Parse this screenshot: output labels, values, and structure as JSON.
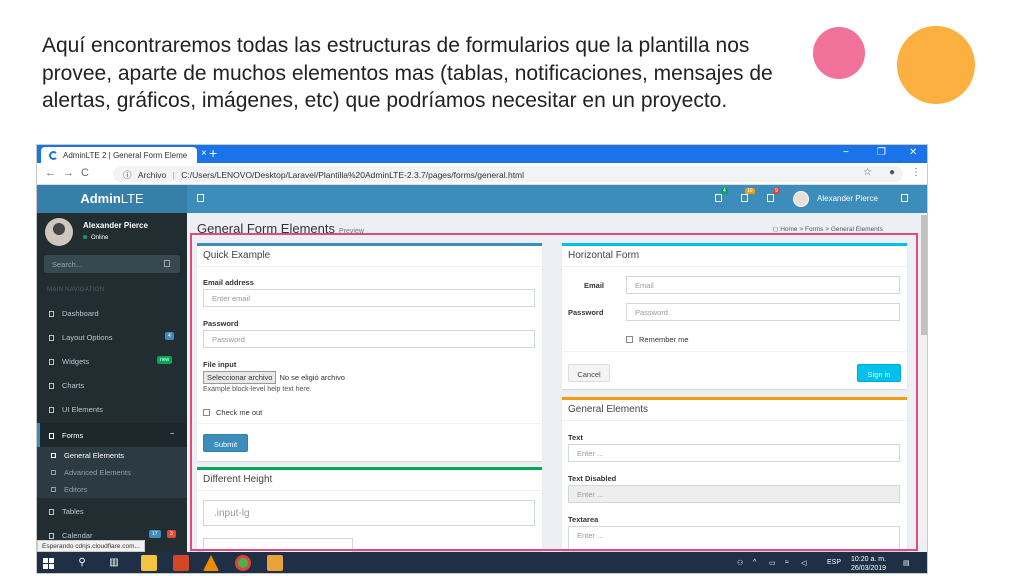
{
  "slide": {
    "title": "Aquí encontraremos todas las estructuras de formularios que la plantilla nos provee, aparte de muchos elementos mas (tablas, notificaciones, mensajes de alertas, gráficos, imágenes, etc) que podríamos necesitar en un proyecto.",
    "colors": {
      "pink_circle": "#f0729a",
      "orange_circle": "#fbb040"
    }
  },
  "browser": {
    "tab_title": "AdminLTE 2 | General Form Eleme",
    "tab_close": "×",
    "new_tab": "+",
    "win_min": "−",
    "win_max": "❐",
    "win_close": "✕",
    "back": "←",
    "forward": "→",
    "reload": "C",
    "info": "ⓘ",
    "url_prefix": "Archivo",
    "url": "C:/Users/LENOVO/Desktop/Laravel/Plantilla%20AdminLTE-2.3.7/pages/forms/general.html",
    "star": "☆",
    "account": "●",
    "menu": "⋮",
    "status_text": "Esperando cdnjs.cloudflare.com..."
  },
  "header": {
    "logo_bold": "Admin",
    "logo_rest": "LTE",
    "toggle": "",
    "badges": [
      "4",
      "10",
      "9"
    ],
    "badge_colors": [
      "#00a65a",
      "#f39c12",
      "#dd4b39"
    ],
    "user_name": "Alexander Pierce",
    "accent": "#3c8dbc"
  },
  "sidebar": {
    "user_name": "Alexander Pierce",
    "status": "Online",
    "search_placeholder": "Search...",
    "nav_header": "MAIN NAVIGATION",
    "items": [
      {
        "label": "Dashboard"
      },
      {
        "label": "Layout Options",
        "badge": "4",
        "badge_color": "#3c8dbc"
      },
      {
        "label": "Widgets",
        "badge": "new",
        "badge_color": "#00a65a"
      },
      {
        "label": "Charts"
      },
      {
        "label": "UI Elements"
      },
      {
        "label": "Forms",
        "toggle": "−"
      },
      {
        "label": "Tables"
      },
      {
        "label": "Calendar",
        "badge": "17",
        "badge2": "3"
      }
    ],
    "sub_items": [
      {
        "label": "General Elements"
      },
      {
        "label": "Advanced Elements"
      },
      {
        "label": "Editors"
      }
    ]
  },
  "content": {
    "title": "General Form Elements",
    "subtitle": "Preview",
    "breadcrumb": [
      "Home",
      "Forms",
      "General Elements"
    ],
    "breadcrumb_sep": ">"
  },
  "quick_example": {
    "title": "Quick Example",
    "email_label": "Email address",
    "email_placeholder": "Enter email",
    "password_label": "Password",
    "password_placeholder": "Password",
    "file_label": "File input",
    "file_button": "Seleccionar archivo",
    "file_status": "No se eligió archivo",
    "help_text": "Example block-level help text here.",
    "check_label": "Check me out",
    "submit": "Submit"
  },
  "different_height": {
    "title": "Different Height",
    "lg_placeholder": ".input-lg"
  },
  "horizontal_form": {
    "title": "Horizontal Form",
    "email_label": "Email",
    "email_placeholder": "Email",
    "password_label": "Password",
    "password_placeholder": "Password",
    "remember": "Remember me",
    "cancel": "Cancel",
    "sign_in": "Sign in"
  },
  "general_elements": {
    "title": "General Elements",
    "text_label": "Text",
    "text_placeholder": "Enter ...",
    "disabled_label": "Text Disabled",
    "disabled_placeholder": "Enter ...",
    "textarea_label": "Textarea",
    "textarea_placeholder": "Enter ..."
  },
  "taskbar": {
    "lang": "ESP",
    "time": "10:20 a. m.",
    "date": "26/03/2019"
  }
}
